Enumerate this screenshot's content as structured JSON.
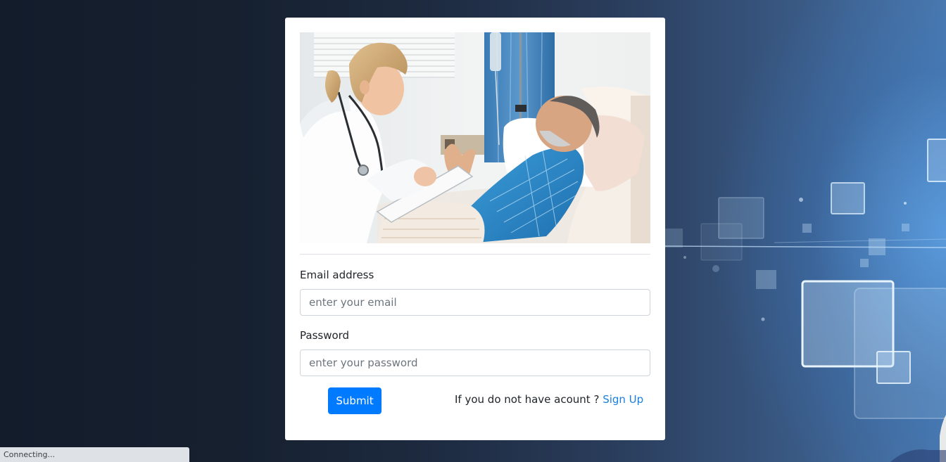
{
  "login_form": {
    "email_label": "Email address",
    "email_placeholder": "enter your email",
    "password_label": "Password",
    "password_placeholder": "enter your password",
    "submit_label": "Submit",
    "signup_prompt": "If you do not have acount ? ",
    "signup_link": "Sign Up"
  },
  "status_bar": {
    "text": "Connecting..."
  },
  "colors": {
    "primary": "#007bff",
    "link": "#1a7fe0"
  }
}
